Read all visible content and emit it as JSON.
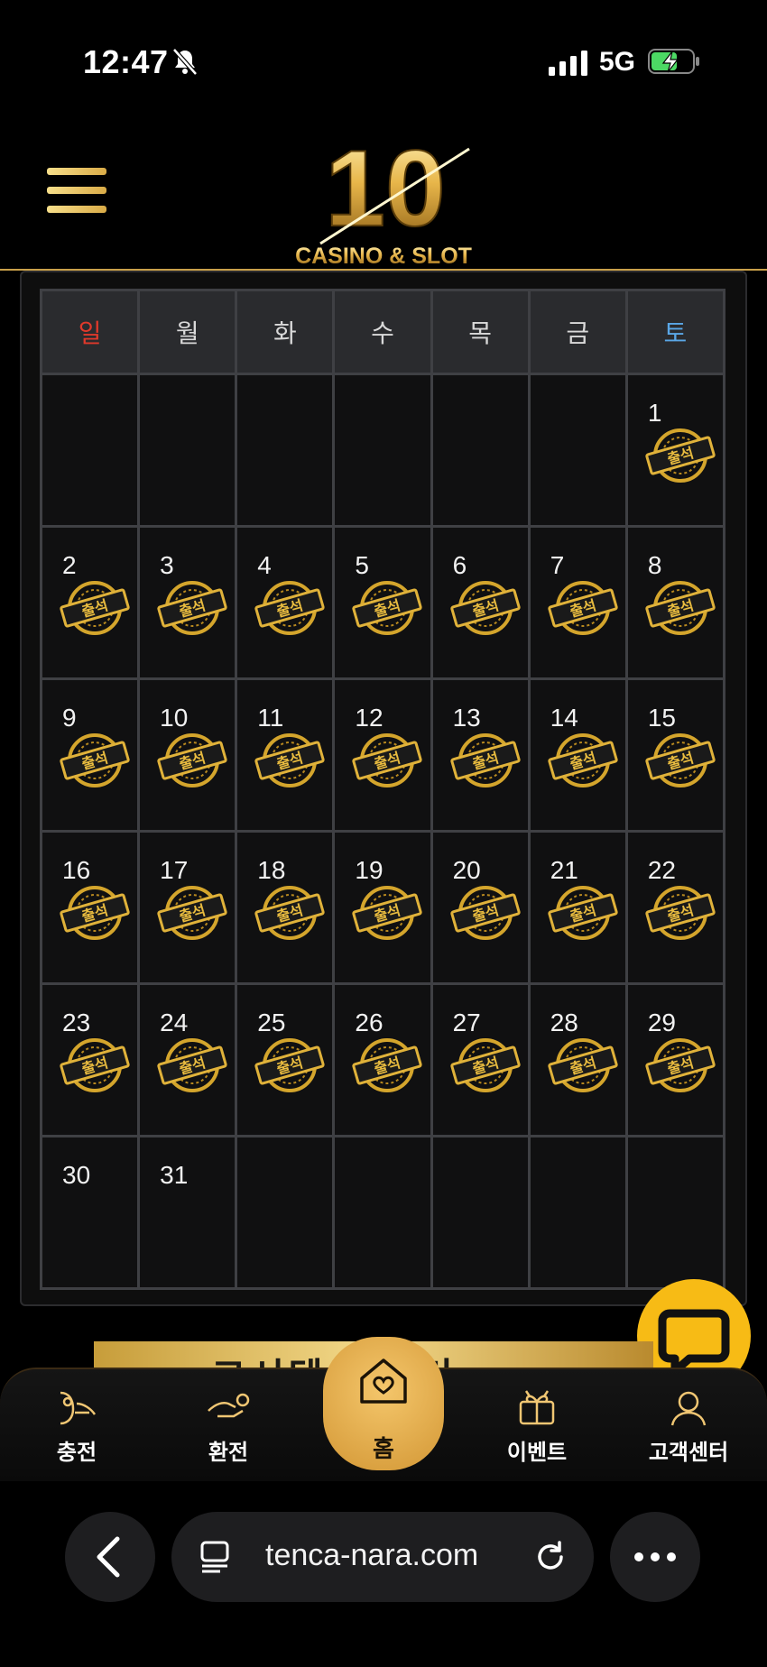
{
  "status_bar": {
    "time": "12:47",
    "network": "5G"
  },
  "header": {
    "logo_number": "10",
    "logo_text": "CASINO & SLOT"
  },
  "calendar": {
    "weekdays": [
      "일",
      "월",
      "화",
      "수",
      "목",
      "금",
      "토"
    ],
    "stamp_label": "출석",
    "weeks": [
      [
        {
          "day": "",
          "stamp": false
        },
        {
          "day": "",
          "stamp": false
        },
        {
          "day": "",
          "stamp": false
        },
        {
          "day": "",
          "stamp": false
        },
        {
          "day": "",
          "stamp": false
        },
        {
          "day": "",
          "stamp": false
        },
        {
          "day": "1",
          "stamp": true
        }
      ],
      [
        {
          "day": "2",
          "stamp": true
        },
        {
          "day": "3",
          "stamp": true
        },
        {
          "day": "4",
          "stamp": true
        },
        {
          "day": "5",
          "stamp": true
        },
        {
          "day": "6",
          "stamp": true
        },
        {
          "day": "7",
          "stamp": true
        },
        {
          "day": "8",
          "stamp": true
        }
      ],
      [
        {
          "day": "9",
          "stamp": true
        },
        {
          "day": "10",
          "stamp": true
        },
        {
          "day": "11",
          "stamp": true
        },
        {
          "day": "12",
          "stamp": true
        },
        {
          "day": "13",
          "stamp": true
        },
        {
          "day": "14",
          "stamp": true
        },
        {
          "day": "15",
          "stamp": true
        }
      ],
      [
        {
          "day": "16",
          "stamp": true
        },
        {
          "day": "17",
          "stamp": true
        },
        {
          "day": "18",
          "stamp": true
        },
        {
          "day": "19",
          "stamp": true
        },
        {
          "day": "20",
          "stamp": true
        },
        {
          "day": "21",
          "stamp": true
        },
        {
          "day": "22",
          "stamp": true
        }
      ],
      [
        {
          "day": "23",
          "stamp": true
        },
        {
          "day": "24",
          "stamp": true
        },
        {
          "day": "25",
          "stamp": true
        },
        {
          "day": "26",
          "stamp": true
        },
        {
          "day": "27",
          "stamp": true
        },
        {
          "day": "28",
          "stamp": true
        },
        {
          "day": "29",
          "stamp": true
        }
      ],
      [
        {
          "day": "30",
          "stamp": false
        },
        {
          "day": "31",
          "stamp": false
        },
        {
          "day": "",
          "stamp": false
        },
        {
          "day": "",
          "stamp": false
        },
        {
          "day": "",
          "stamp": false
        },
        {
          "day": "",
          "stamp": false
        },
        {
          "day": "",
          "stamp": false
        }
      ]
    ]
  },
  "banner": {
    "text": "고시텐 개에씨"
  },
  "bottom_nav": {
    "charge": "충전",
    "exchange": "환전",
    "home": "홈",
    "event": "이벤트",
    "support": "고객센터"
  },
  "browser": {
    "url": "tenca-nara.com"
  },
  "colors": {
    "gold": "#d9ab47",
    "sunday": "#e0392b",
    "saturday": "#5aa7e6",
    "chat": "#f7bb15"
  }
}
